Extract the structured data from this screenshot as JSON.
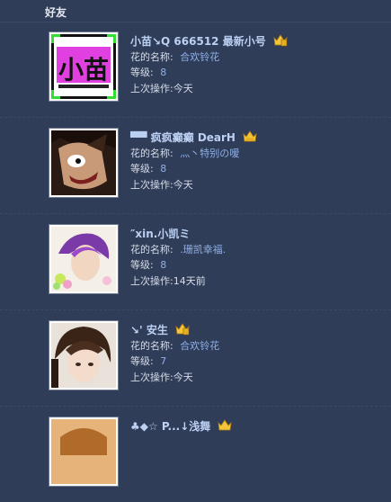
{
  "header": {
    "title": "好友"
  },
  "friends": [
    {
      "name": "小苗↘Q 666512 最新小号",
      "flower_label": "花的名称:",
      "flower_name": "合欢铃花",
      "level_label": "等级:",
      "level": "8",
      "last_action_label": "上次操作:",
      "last_action": "今天",
      "avatar_text": "小苗"
    },
    {
      "name": "▀▀ 疯疯癫癫   DearH",
      "flower_label": "花的名称:",
      "flower_name": "灬丶特别の嗳",
      "level_label": "等级:",
      "level": "8",
      "last_action_label": "上次操作:",
      "last_action": "今天"
    },
    {
      "name": "″xin.小凯ミ",
      "flower_label": "花的名称:",
      "flower_name": ".珊凯幸福.",
      "level_label": "等级:",
      "level": "8",
      "last_action_label": "上次操作:",
      "last_action": "14天前"
    },
    {
      "name": "↘'    安生",
      "flower_label": "花的名称:",
      "flower_name": "合欢铃花",
      "level_label": "等级:",
      "level": "7",
      "last_action_label": "上次操作:",
      "last_action": "今天"
    },
    {
      "name": "♣◆☆ P...↓浅舞"
    }
  ],
  "colors": {
    "background": "#2f3d59",
    "name": "#bcd0f2",
    "value": "#8fb0e6",
    "vip_gold": "#f2c53a"
  },
  "icons": {
    "vip_badge": "vip-crown-icon"
  }
}
